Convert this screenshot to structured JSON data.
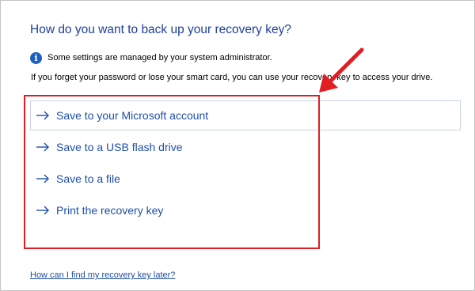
{
  "dialog": {
    "title": "How do you want to back up your recovery key?",
    "info": {
      "icon": "info-icon",
      "glyph": "i",
      "text": "Some settings are managed by your system administrator."
    },
    "description": "If you forget your password or lose your smart card, you can use your recovery key to access your drive.",
    "options": [
      {
        "label": "Save to your Microsoft account",
        "selected": true
      },
      {
        "label": "Save to a USB flash drive",
        "selected": false
      },
      {
        "label": "Save to a file",
        "selected": false
      },
      {
        "label": "Print the recovery key",
        "selected": false
      }
    ],
    "help_link": "How can I find my recovery key later?"
  },
  "annotation": {
    "box_color": "#e01e24",
    "arrow_color": "#e01e24"
  },
  "colors": {
    "title": "#1e3f9a",
    "link": "#1e4fa8",
    "info_icon": "#1d5fbf",
    "selected_border": "#c9d4e4"
  }
}
